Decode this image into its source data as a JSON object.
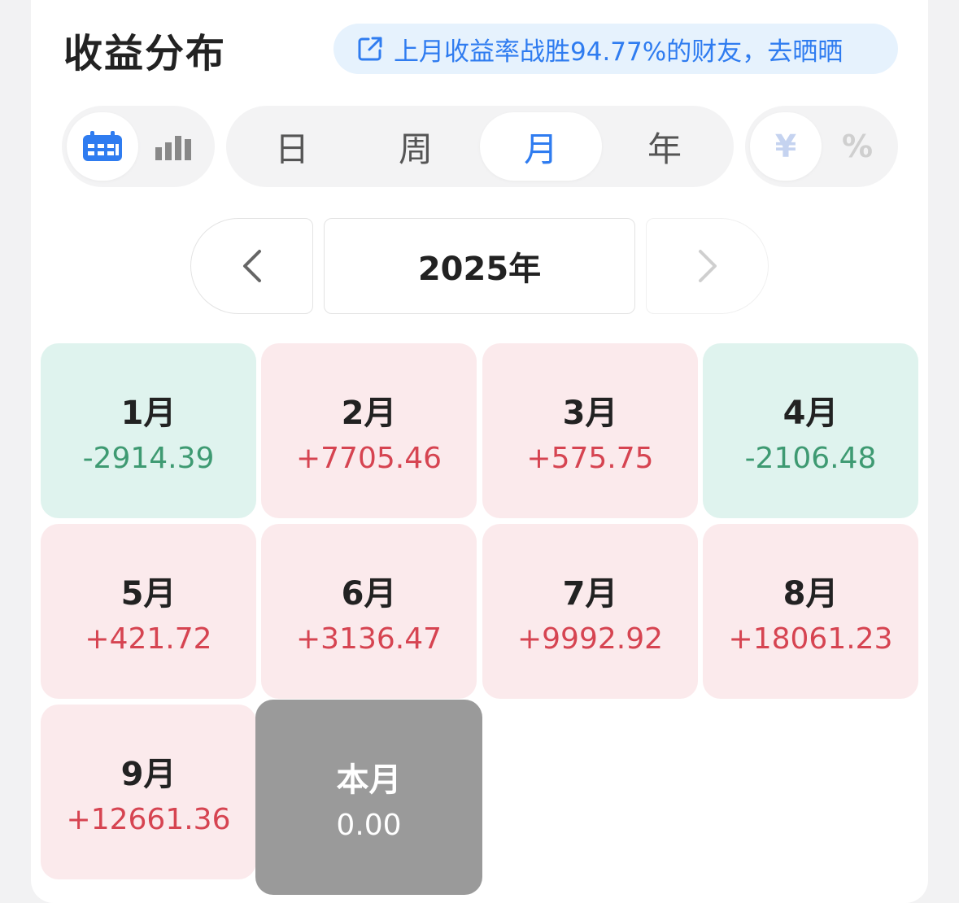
{
  "header": {
    "title": "收益分布",
    "share_text": "上月收益率战胜94.77%的财友，去晒晒"
  },
  "view_toggle": {
    "calendar_icon": "calendar-icon",
    "bar_icon": "bar-chart-icon",
    "active": "calendar"
  },
  "period_tabs": [
    {
      "label": "日",
      "active": false
    },
    {
      "label": "周",
      "active": false
    },
    {
      "label": "月",
      "active": true
    },
    {
      "label": "年",
      "active": false
    }
  ],
  "unit_toggle": {
    "currency": "¥",
    "percent": "%"
  },
  "year_nav": {
    "year": "2025年"
  },
  "months": [
    {
      "label": "1月",
      "value": "-2914.39",
      "trend": "down"
    },
    {
      "label": "2月",
      "value": "+7705.46",
      "trend": "up"
    },
    {
      "label": "3月",
      "value": "+575.75",
      "trend": "up"
    },
    {
      "label": "4月",
      "value": "-2106.48",
      "trend": "down"
    },
    {
      "label": "5月",
      "value": "+421.72",
      "trend": "up"
    },
    {
      "label": "6月",
      "value": "+3136.47",
      "trend": "up"
    },
    {
      "label": "7月",
      "value": "+9992.92",
      "trend": "up"
    },
    {
      "label": "8月",
      "value": "+18061.23",
      "trend": "up"
    },
    {
      "label": "9月",
      "value": "+12661.36",
      "trend": "up"
    },
    {
      "label": "本月",
      "value": "0.00",
      "trend": "current"
    }
  ],
  "colors": {
    "accent": "#2f7cf0",
    "gain": "#d64451",
    "loss": "#3e9a72"
  }
}
